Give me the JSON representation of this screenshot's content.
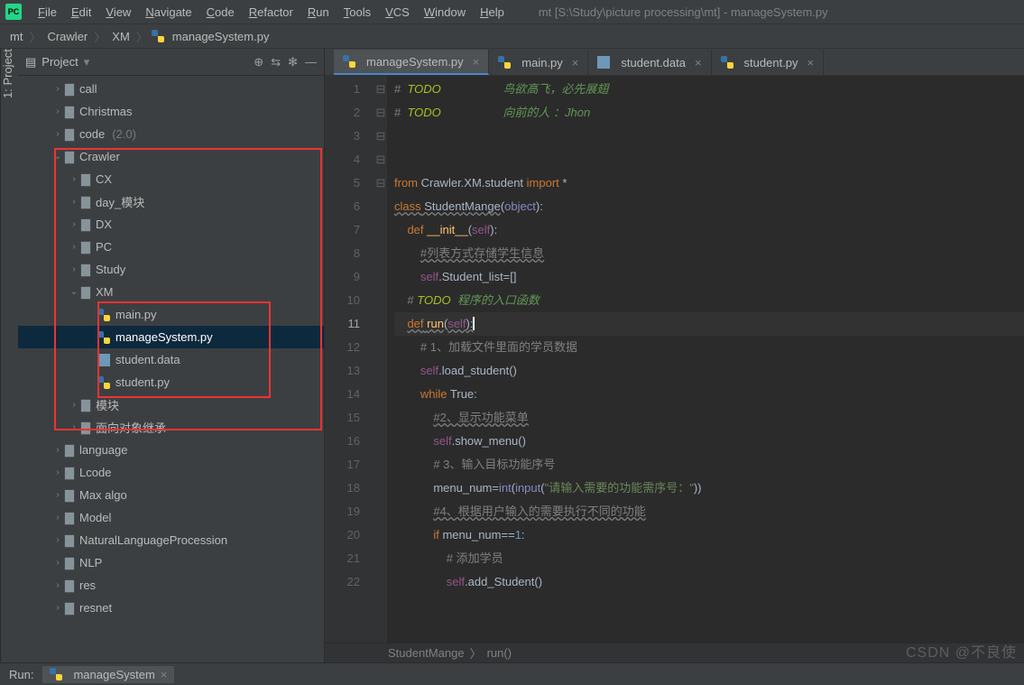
{
  "menubar": {
    "items": [
      "File",
      "Edit",
      "View",
      "Navigate",
      "Code",
      "Refactor",
      "Run",
      "Tools",
      "VCS",
      "Window",
      "Help"
    ],
    "title": "mt [S:\\Study\\picture processing\\mt] - manageSystem.py"
  },
  "breadcrumb": [
    "mt",
    "Crawler",
    "XM",
    "manageSystem.py"
  ],
  "panel": {
    "title": "Project"
  },
  "tree": [
    {
      "d": 2,
      "ar": "›",
      "ic": "folder",
      "t": "call"
    },
    {
      "d": 2,
      "ar": "›",
      "ic": "folder",
      "t": "Christmas"
    },
    {
      "d": 2,
      "ar": "›",
      "ic": "folder",
      "t": "code",
      "dim": "(2.0)"
    },
    {
      "d": 2,
      "ar": "⌄",
      "ic": "folder",
      "t": "Crawler"
    },
    {
      "d": 3,
      "ar": "›",
      "ic": "folder",
      "t": "CX"
    },
    {
      "d": 3,
      "ar": "›",
      "ic": "folder",
      "t": "day_模块"
    },
    {
      "d": 3,
      "ar": "›",
      "ic": "folder",
      "t": "DX"
    },
    {
      "d": 3,
      "ar": "›",
      "ic": "folder",
      "t": "PC"
    },
    {
      "d": 3,
      "ar": "›",
      "ic": "folder",
      "t": "Study"
    },
    {
      "d": 3,
      "ar": "⌄",
      "ic": "folder",
      "t": "XM"
    },
    {
      "d": 4,
      "ar": "",
      "ic": "py",
      "t": "main.py"
    },
    {
      "d": 4,
      "ar": "",
      "ic": "py",
      "t": "manageSystem.py",
      "sel": true
    },
    {
      "d": 4,
      "ar": "",
      "ic": "data",
      "t": "student.data"
    },
    {
      "d": 4,
      "ar": "",
      "ic": "py",
      "t": "student.py"
    },
    {
      "d": 3,
      "ar": "›",
      "ic": "folder",
      "t": "模块"
    },
    {
      "d": 3,
      "ar": "›",
      "ic": "folder",
      "t": "面向对象继承"
    },
    {
      "d": 2,
      "ar": "›",
      "ic": "folder",
      "t": "language"
    },
    {
      "d": 2,
      "ar": "›",
      "ic": "folder",
      "t": "Lcode"
    },
    {
      "d": 2,
      "ar": "›",
      "ic": "folder",
      "t": "Max algo"
    },
    {
      "d": 2,
      "ar": "›",
      "ic": "folder",
      "t": "Model"
    },
    {
      "d": 2,
      "ar": "›",
      "ic": "folder",
      "t": "NaturalLanguageProcession"
    },
    {
      "d": 2,
      "ar": "›",
      "ic": "folder",
      "t": "NLP"
    },
    {
      "d": 2,
      "ar": "›",
      "ic": "folder",
      "t": "res"
    },
    {
      "d": 2,
      "ar": "›",
      "ic": "folder",
      "t": "resnet"
    }
  ],
  "tabs": [
    {
      "t": "manageSystem.py",
      "ic": "py",
      "active": true
    },
    {
      "t": "main.py",
      "ic": "py"
    },
    {
      "t": "student.data",
      "ic": "data"
    },
    {
      "t": "student.py",
      "ic": "py"
    }
  ],
  "editor": {
    "current_line": 11,
    "lines_total": 22,
    "breadcrumb": [
      "StudentMange",
      "run()"
    ],
    "todo1_prefix": "#  TODO",
    "todo1_cn": "鸟欲高飞，必先展翅",
    "todo2_prefix": "#  TODO",
    "todo2_cn": "向前的人 ：Jhon",
    "l5": {
      "kw1": "from",
      "mod": "Crawler.XM.student",
      "kw2": "import",
      "star": "*"
    },
    "l6": {
      "kw": "class",
      "name": "StudentMange",
      "base": "object"
    },
    "l7": {
      "kw": "def",
      "fn": "__init__",
      "self": "self"
    },
    "l8": "#列表方式存储学生信息",
    "l9": {
      "self": "self",
      "attr": ".Student_list=[]"
    },
    "l10": {
      "pre": "# ",
      "todo": "TODO",
      "cn": "  程序的入口函数"
    },
    "l11": {
      "kw": "def",
      "fn": "run",
      "self": "self"
    },
    "l12": "# 1、加载文件里面的学员数据",
    "l13": {
      "self": "self",
      "call": ".load_student()"
    },
    "l14": {
      "kw": "while",
      "t": " True:"
    },
    "l15": "#2、显示功能菜单",
    "l16": {
      "self": "self",
      "call": ".show_menu()"
    },
    "l17": "# 3、输入目标功能序号",
    "l18": {
      "v": "menu_num=",
      "bi1": "int",
      "p1": "(",
      "bi2": "input",
      "p2": "(",
      "str": "\"请输入需要的功能需序号：\"",
      "p3": "))"
    },
    "l19": "#4、根据用户输入的需要执行不同的功能",
    "l20": {
      "kw": "if",
      "v": " menu_num==",
      "num": "1",
      "c": ":"
    },
    "l21": "# 添加学员",
    "l22": {
      "self": "self",
      "call": ".add_Student()"
    }
  },
  "run": {
    "label": "Run:",
    "config": "manageSystem"
  },
  "watermark": "CSDN @不良使"
}
